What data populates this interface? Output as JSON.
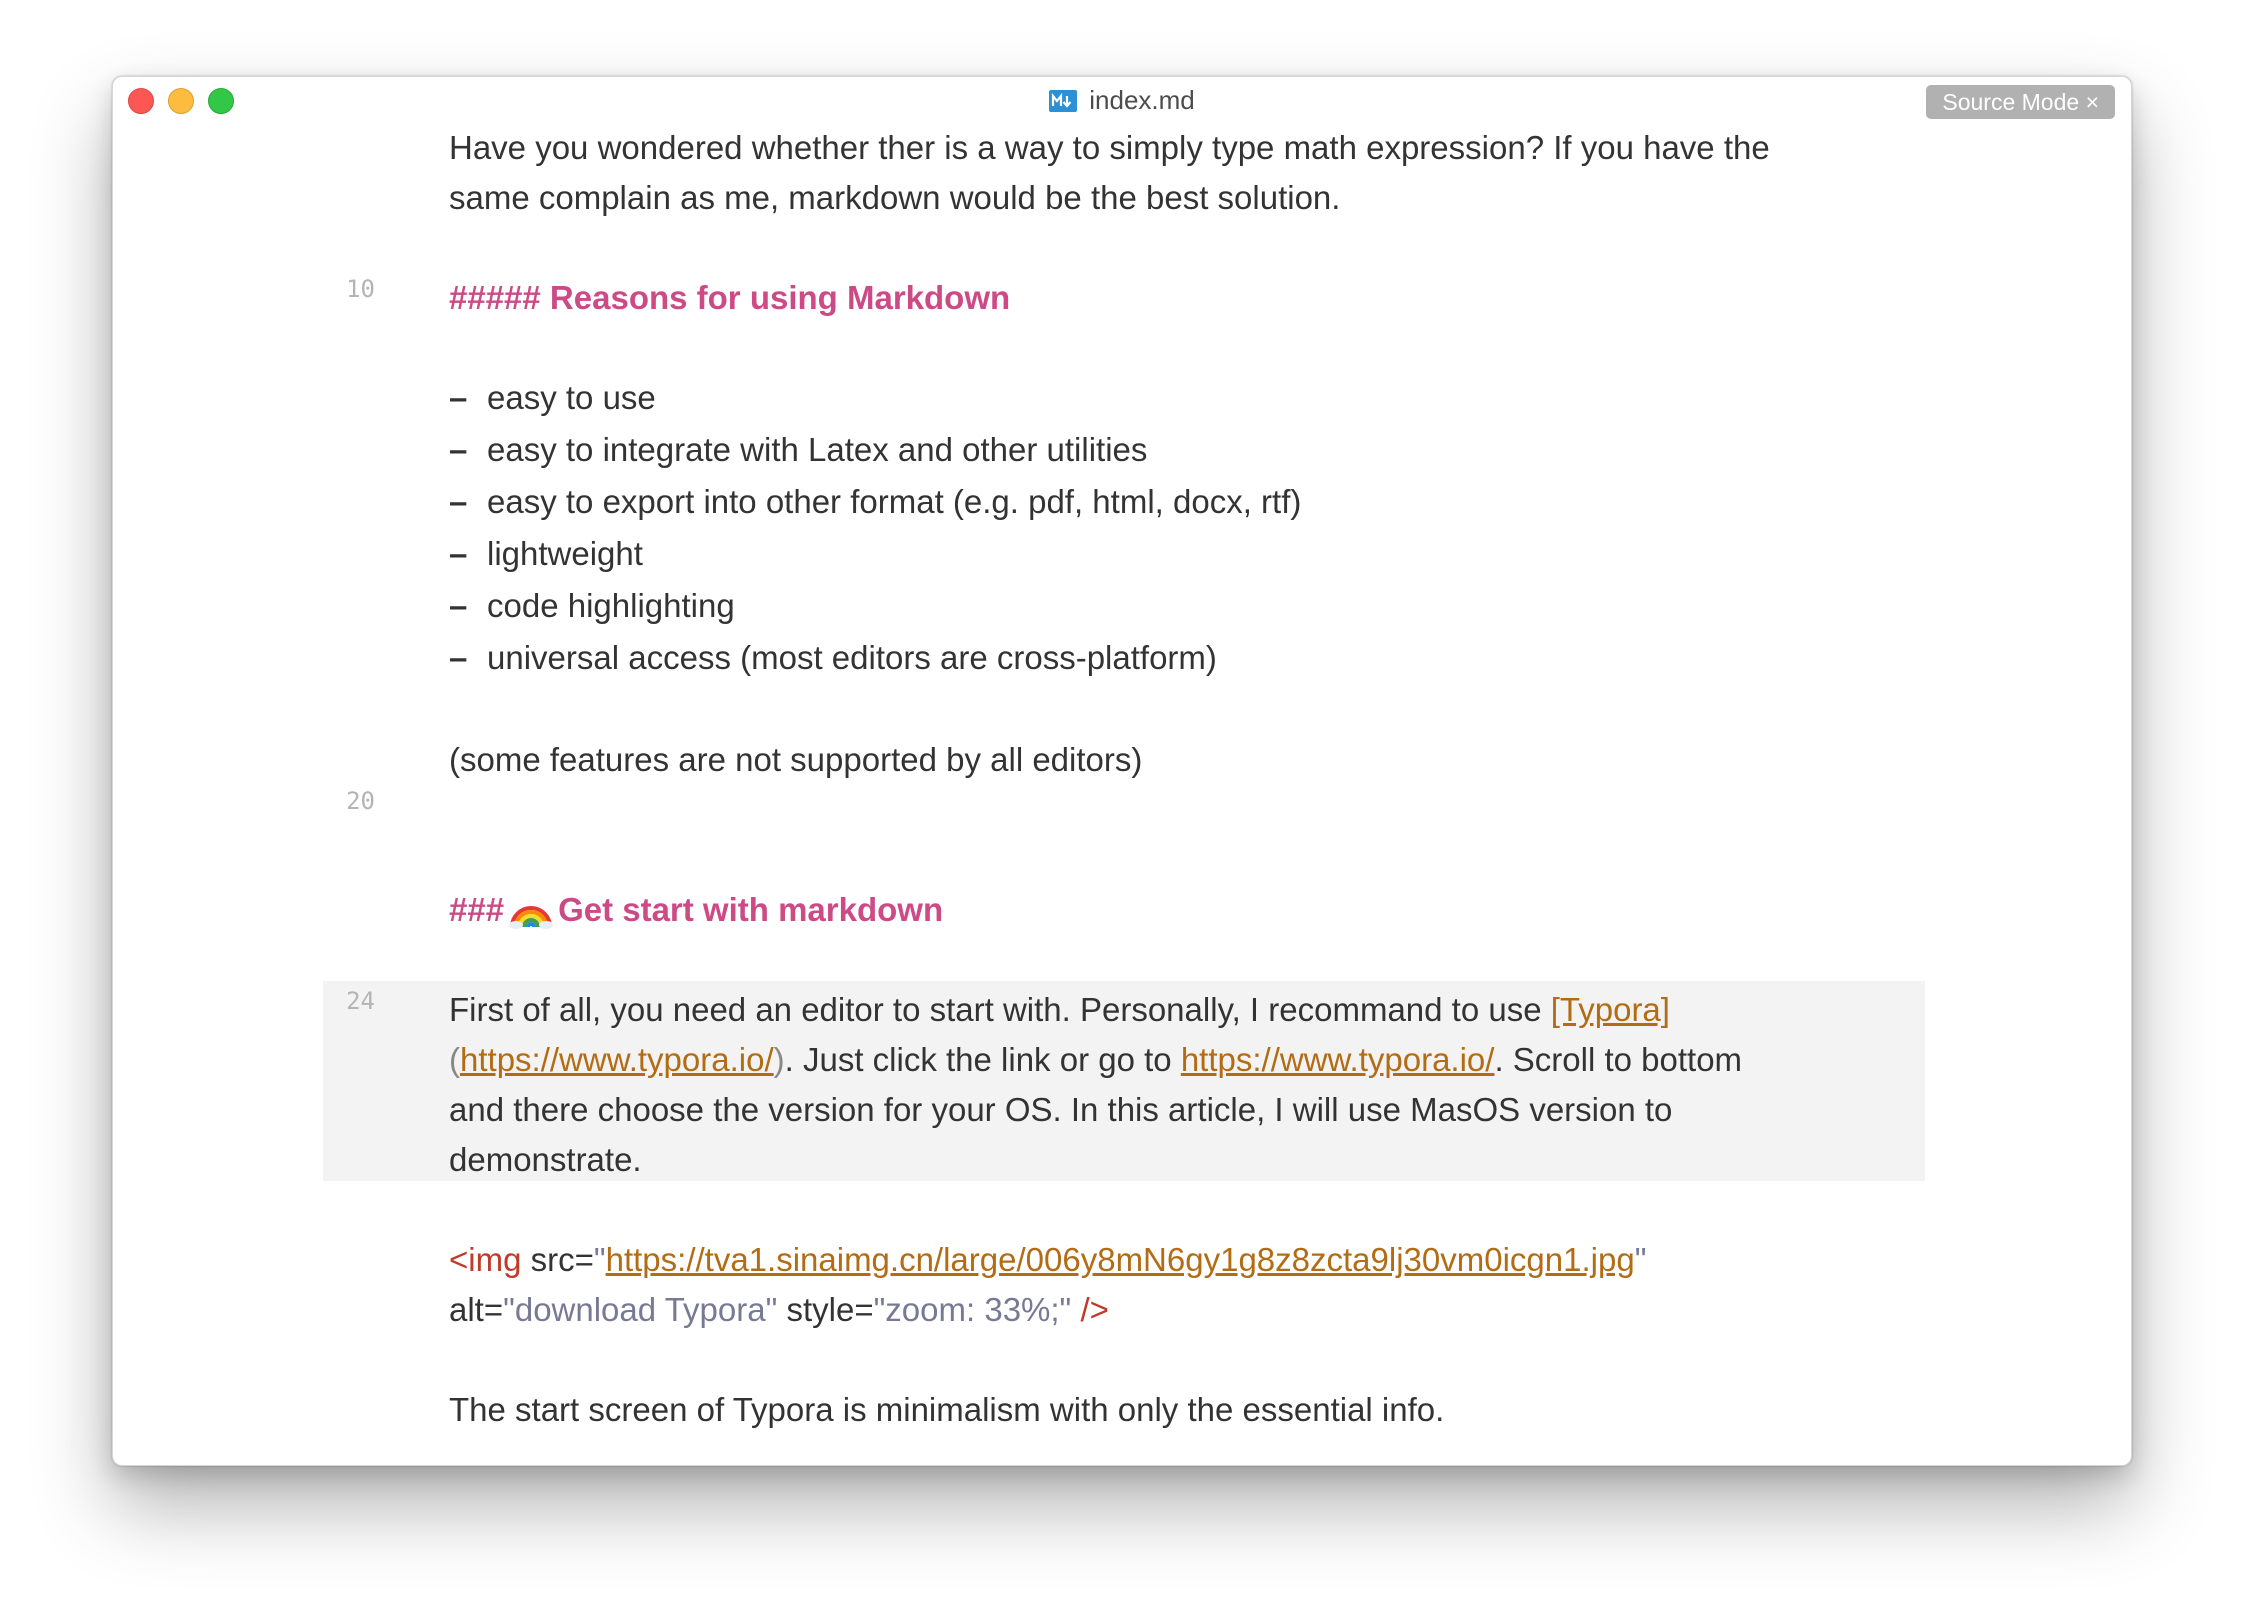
{
  "window": {
    "title": "index.md",
    "source_mode_label": "Source Mode ×"
  },
  "line_numbers": [
    "10",
    "20",
    "24"
  ],
  "content": {
    "intro_1": "Have you wondered whether ther is a way to simply type math expression? If you have the",
    "intro_2": "same complain as me, markdown would be the best solution.",
    "heading_reasons": "##### Reasons for using Markdown",
    "list_marker": "–",
    "reasons": [
      "easy to use",
      "easy to integrate with Latex and other utilities",
      "easy to export into other format (e.g. pdf, html, docx, rtf)",
      "lightweight",
      "code highlighting",
      "universal access (most editors are cross-platform)"
    ],
    "note": "(some features are not supported by all editors)",
    "heading_start_prefix": "###",
    "heading_start_text": "Get start with markdown",
    "para": {
      "l1_text": "First of all, you need an editor to start with. Personally, I recommand to use ",
      "l1_link_text": "[Typora]",
      "l2_open": "(",
      "l2_url": "https://www.typora.io/",
      "l2_close": ")",
      "l2_mid": ". Just click the link or go to ",
      "l2_link": "https://www.typora.io/",
      "l2_end": ". Scroll to bottom",
      "l3": "and there choose the version for your OS. In this article, I will use MasOS version to",
      "l4": "demonstrate."
    },
    "img": {
      "tag_open": "<img",
      "src_attr": " src=",
      "quote": "\"",
      "src_url": "https://tva1.sinaimg.cn/large/006y8mN6gy1g8z8zcta9lj30vm0icgn1.jpg",
      "alt_attr": "alt=",
      "alt_val": "\"download Typora\"",
      "style_attr": " style=",
      "style_val": "\"zoom: 33%;\"",
      "tag_close": " />"
    },
    "last": "The start screen of Typora is minimalism with only the essential info."
  }
}
